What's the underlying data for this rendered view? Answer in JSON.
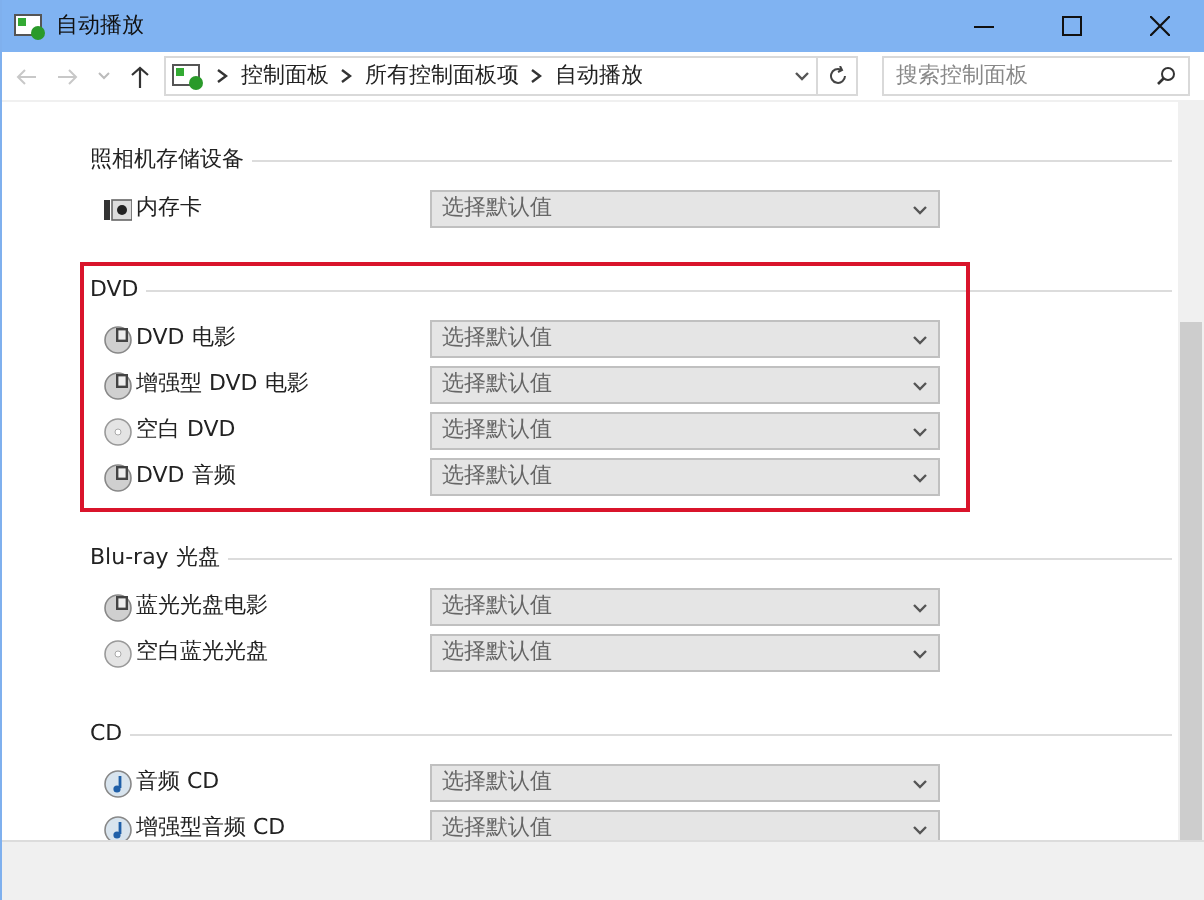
{
  "window": {
    "title": "自动播放"
  },
  "navigation": {
    "back_disabled": true,
    "forward_disabled": true,
    "breadcrumbs": [
      "控制面板",
      "所有控制面板项",
      "自动播放"
    ]
  },
  "search": {
    "placeholder": "搜索控制面板"
  },
  "sections": [
    {
      "title": "照相机存储设备",
      "highlighted": false,
      "items": [
        {
          "kind": "card",
          "label": "内存卡",
          "value": "选择默认值"
        }
      ]
    },
    {
      "title": "DVD",
      "highlighted": true,
      "items": [
        {
          "kind": "movie",
          "label": "DVD 电影",
          "value": "选择默认值"
        },
        {
          "kind": "movie",
          "label": "增强型 DVD 电影",
          "value": "选择默认值"
        },
        {
          "kind": "blank",
          "label": "空白 DVD",
          "value": "选择默认值"
        },
        {
          "kind": "movie",
          "label": "DVD 音频",
          "value": "选择默认值"
        }
      ]
    },
    {
      "title": "Blu-ray 光盘",
      "highlighted": false,
      "items": [
        {
          "kind": "movie",
          "label": "蓝光光盘电影",
          "value": "选择默认值"
        },
        {
          "kind": "blank",
          "label": "空白蓝光光盘",
          "value": "选择默认值"
        }
      ]
    },
    {
      "title": "CD",
      "highlighted": false,
      "items": [
        {
          "kind": "audio",
          "label": "音频 CD",
          "value": "选择默认值"
        },
        {
          "kind": "audio",
          "label": "增强型音频 CD",
          "value": "选择默认值"
        }
      ]
    }
  ]
}
